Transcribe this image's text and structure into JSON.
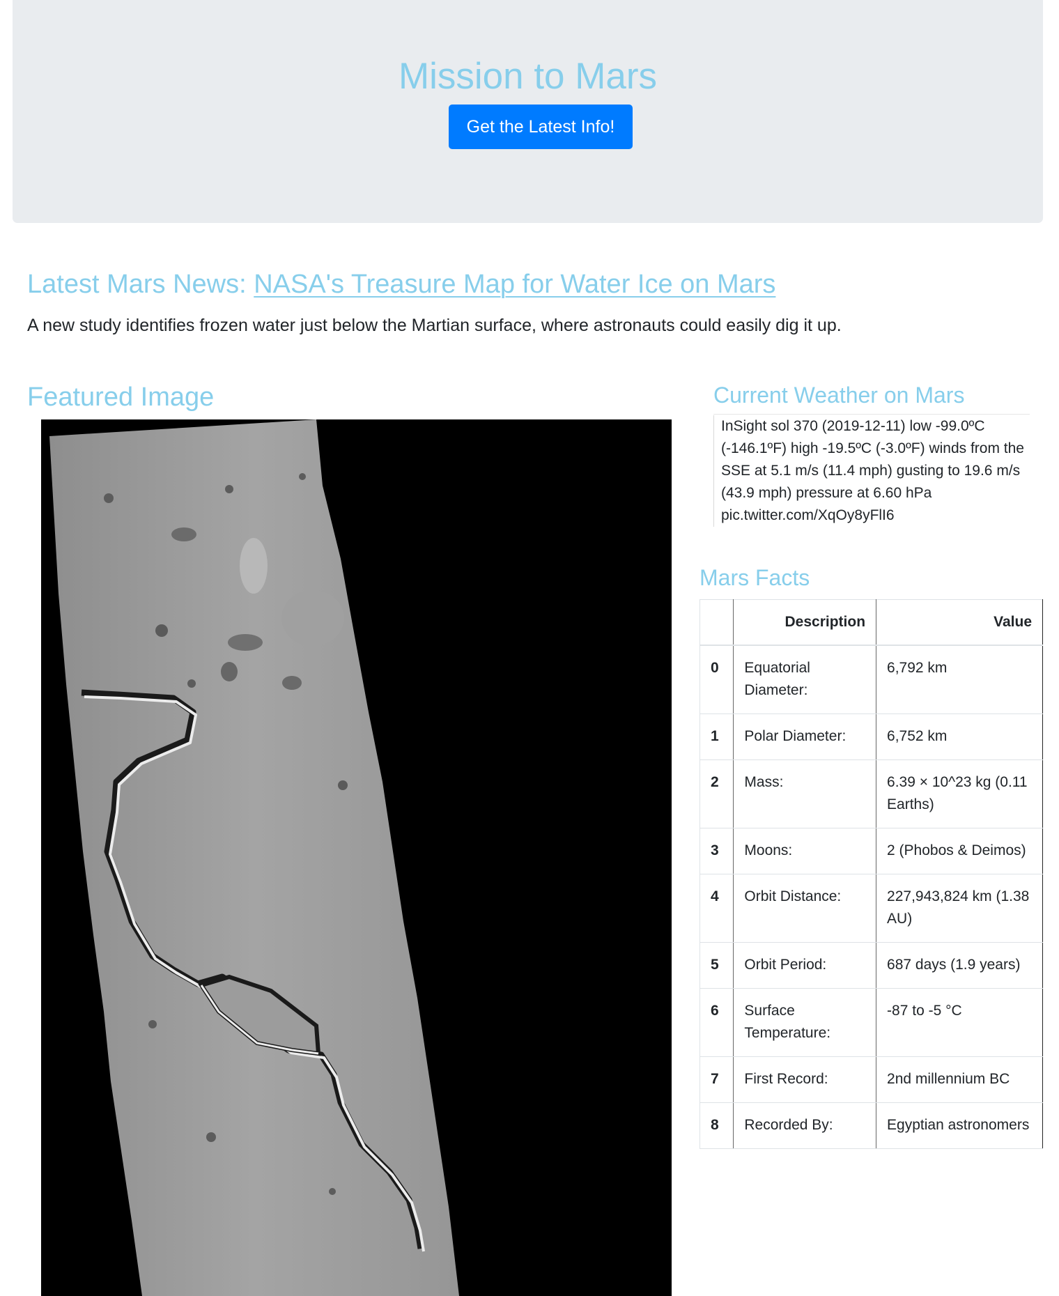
{
  "jumbotron": {
    "title": "Mission to Mars",
    "button_label": "Get the Latest Info!"
  },
  "news": {
    "heading_prefix": "Latest Mars News:",
    "title": "NASA's Treasure Map for Water Ice on Mars",
    "teaser": "A new study identifies frozen water just below the Martian surface, where astronauts could easily dig it up."
  },
  "featured": {
    "heading": "Featured Image"
  },
  "weather": {
    "heading": "Current Weather on Mars",
    "text": "InSight sol 370 (2019-12-11) low -99.0ºC (-146.1ºF) high -19.5ºC (-3.0ºF) winds from the SSE at 5.1 m/s (11.4 mph) gusting to 19.6 m/s (43.9 mph) pressure at 6.60 hPa pic.twitter.com/XqOy8yFlI6"
  },
  "facts": {
    "heading": "Mars Facts",
    "columns": [
      "",
      "Description",
      "Value"
    ],
    "rows": [
      {
        "index": "0",
        "description": "Equatorial Diameter:",
        "value": "6,792 km"
      },
      {
        "index": "1",
        "description": "Polar Diameter:",
        "value": "6,752 km"
      },
      {
        "index": "2",
        "description": "Mass:",
        "value": "6.39 × 10^23 kg (0.11 Earths)"
      },
      {
        "index": "3",
        "description": "Moons:",
        "value": "2 (Phobos & Deimos)"
      },
      {
        "index": "4",
        "description": "Orbit Distance:",
        "value": "227,943,824 km (1.38 AU)"
      },
      {
        "index": "5",
        "description": "Orbit Period:",
        "value": "687 days (1.9 years)"
      },
      {
        "index": "6",
        "description": "Surface Temperature:",
        "value": "-87 to -5 °C"
      },
      {
        "index": "7",
        "description": "First Record:",
        "value": "2nd millennium BC"
      },
      {
        "index": "8",
        "description": "Recorded By:",
        "value": "Egyptian astronomers"
      }
    ]
  },
  "colors": {
    "heading": "#87ceeb",
    "button": "#007bff",
    "jumbotron_bg": "#e9ecef",
    "text": "#212529"
  }
}
